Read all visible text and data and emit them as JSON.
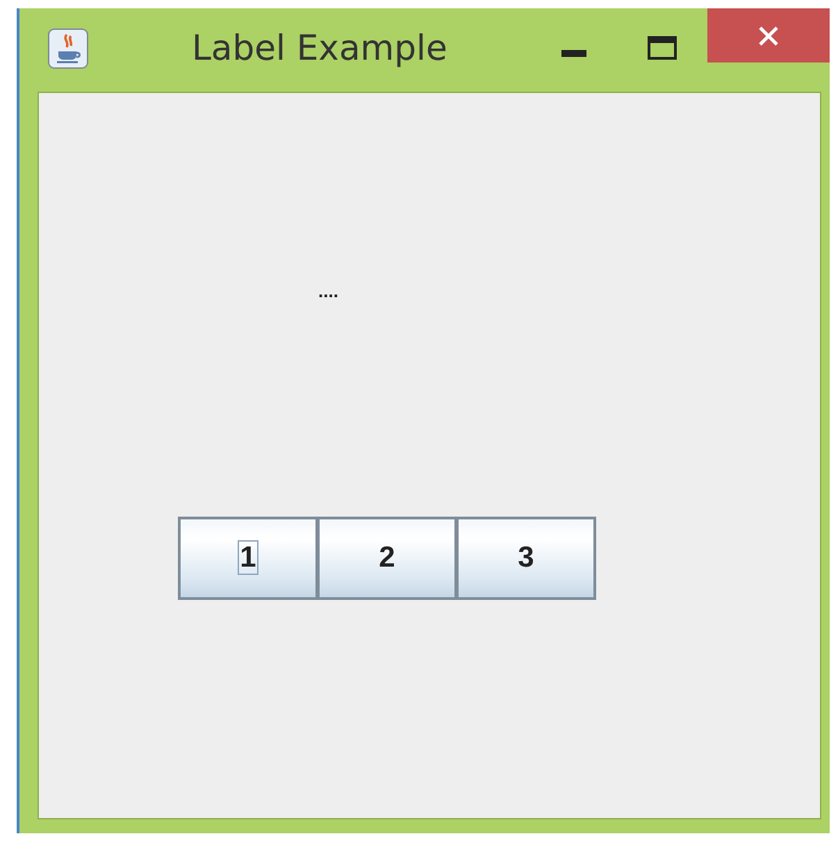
{
  "window": {
    "title": "Label Example"
  },
  "label": {
    "text": "...."
  },
  "buttons": [
    {
      "label": "1",
      "focused": true
    },
    {
      "label": "2",
      "focused": false
    },
    {
      "label": "3",
      "focused": false
    }
  ]
}
